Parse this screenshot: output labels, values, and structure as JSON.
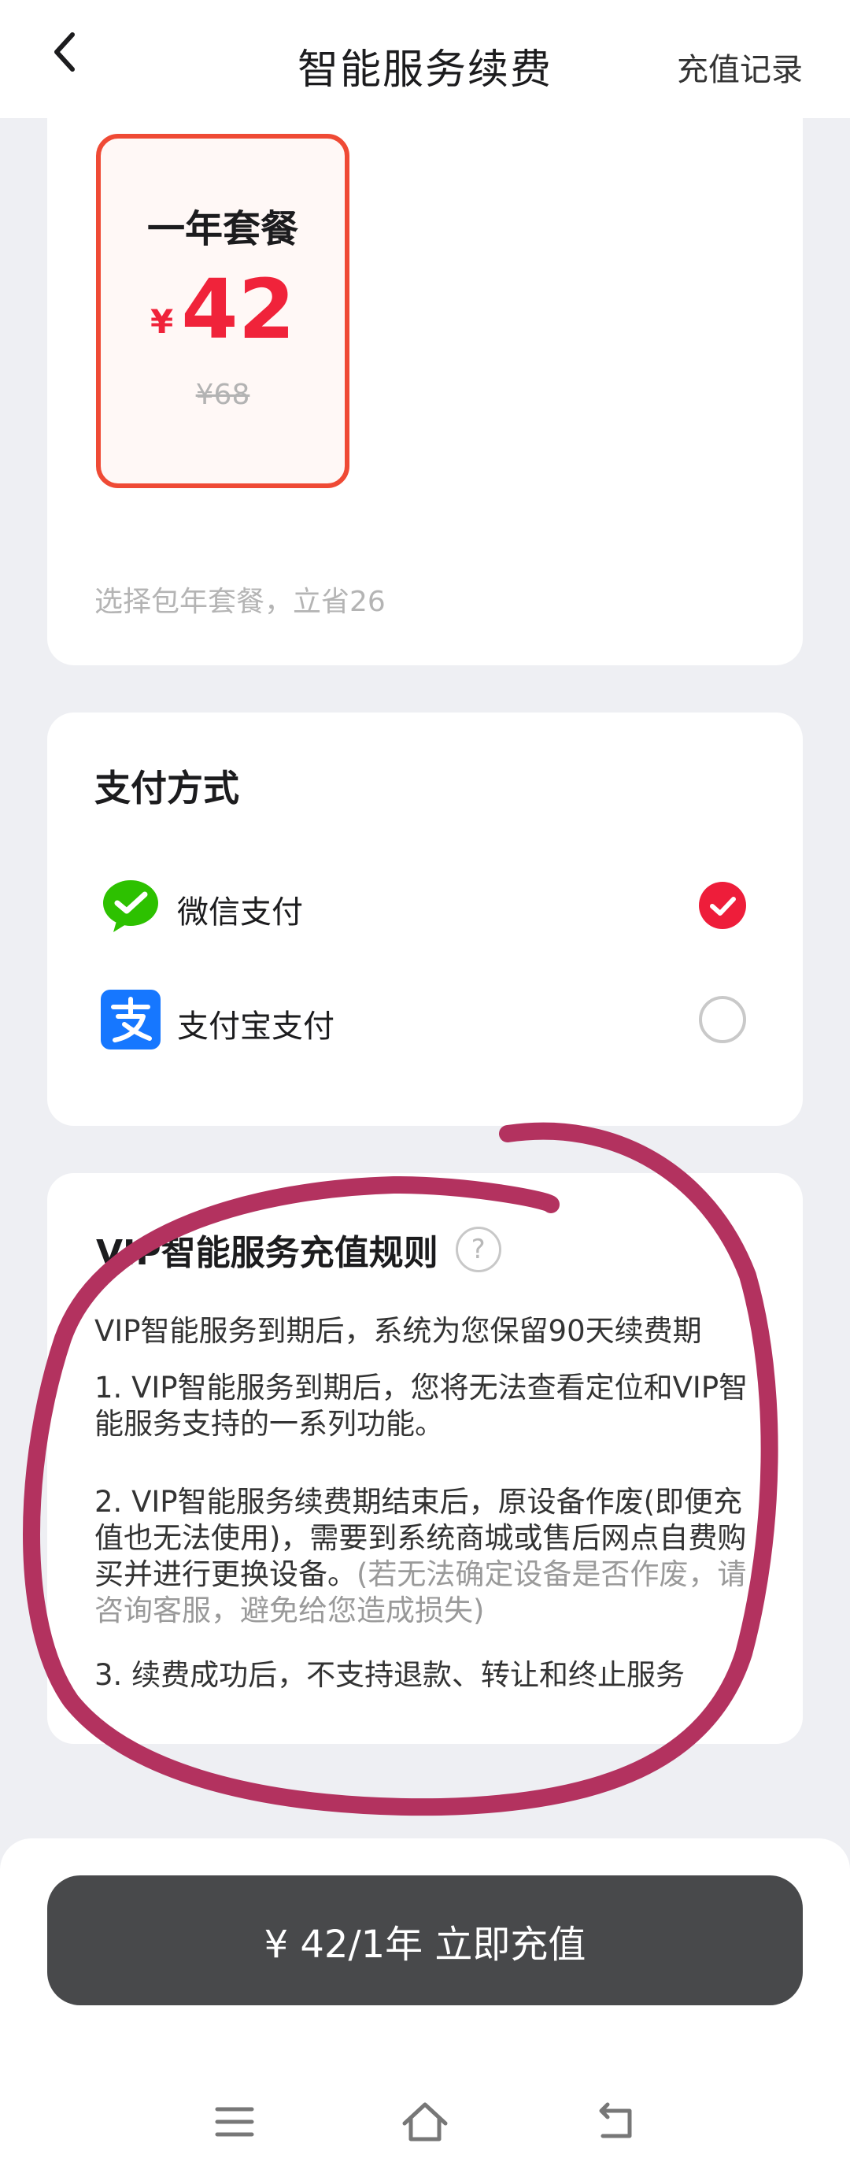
{
  "header": {
    "title": "智能服务续费",
    "action": "充值记录"
  },
  "plan": {
    "name": "一年套餐",
    "currency": "¥",
    "price": "42",
    "original_price": "¥68",
    "hint": "选择包年套餐，立省26"
  },
  "payment": {
    "title": "支付方式",
    "options": [
      {
        "label": "微信支付",
        "selected": true
      },
      {
        "label": "支付宝支付",
        "selected": false
      }
    ]
  },
  "rules": {
    "title": "VIP智能服务充值规则",
    "help_symbol": "?",
    "intro": "VIP智能服务到期后，系统为您保留90天续费期",
    "item1": "1. VIP智能服务到期后，您将无法查看定位和VIP智能服务支持的一系列功能。",
    "item2": "2. VIP智能服务续费期结束后，原设备作废(即便充值也无法使用)，需要到系统商城或售后网点自费购买并进行更换设备。",
    "item2_note": "(若无法确定设备是否作废，请咨询客服，避免给您造成损失)",
    "item3": "3. 续费成功后，不支持退款、转让和终止服务"
  },
  "cta": {
    "label": "¥ 42/1年 立即充值"
  },
  "colors": {
    "accent_red": "#ef4a35",
    "price_red": "#f0233a",
    "wechat_green": "#2dc100",
    "alipay_blue": "#1677ff",
    "button_dark": "#48494b",
    "annotation": "#b3325f"
  }
}
